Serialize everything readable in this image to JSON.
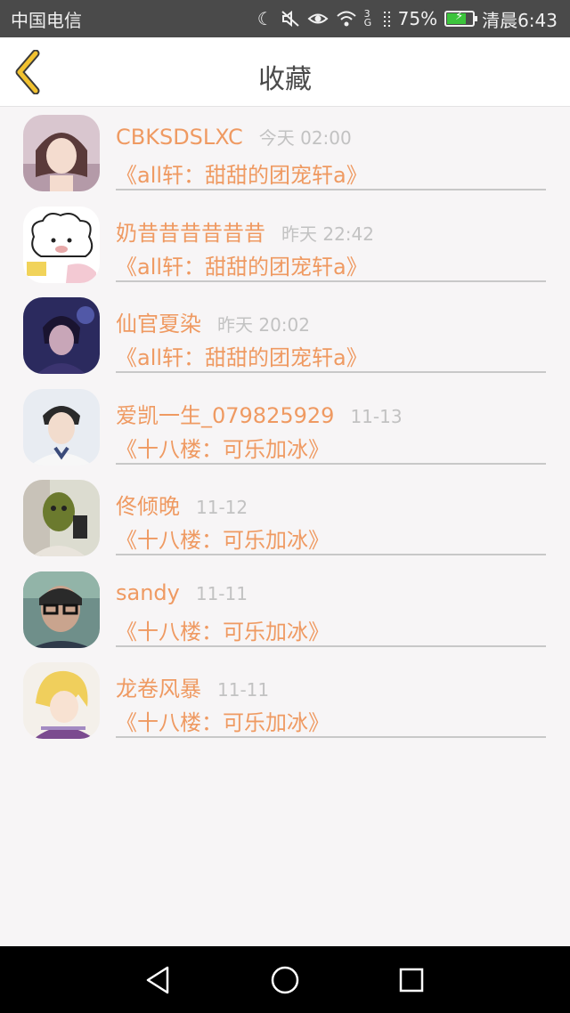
{
  "status_bar": {
    "carrier": "中国电信",
    "network": "3G",
    "battery_percent": "75%",
    "battery_level": 0.75,
    "time": "清晨6:43",
    "icons": [
      "moon-icon",
      "mute-icon",
      "eye-icon",
      "wifi-icon",
      "signal-icon",
      "battery-icon"
    ]
  },
  "header": {
    "title": "收藏",
    "back_icon": "chevron-left-icon",
    "accent_color": "#f2c230"
  },
  "favorites": [
    {
      "user": "CBKSDSLXC",
      "time": "今天 02:00",
      "book": "《all轩：甜甜的团宠轩a》"
    },
    {
      "user": "奶昔昔昔昔昔昔",
      "time": "昨天 22:42",
      "book": "《all轩：甜甜的团宠轩a》"
    },
    {
      "user": "仙官夏染",
      "time": "昨天 20:02",
      "book": "《all轩：甜甜的团宠轩a》"
    },
    {
      "user": "爱凯一生_079825929",
      "time": "11-13",
      "book": "《十八楼：可乐加冰》"
    },
    {
      "user": "佟倾晚",
      "time": "11-12",
      "book": "《十八楼：可乐加冰》"
    },
    {
      "user": "sandy",
      "time": "11-11",
      "book": "《十八楼：可乐加冰》"
    },
    {
      "user": "龙卷风暴",
      "time": "11-11",
      "book": "《十八楼：可乐加冰》"
    }
  ],
  "colors": {
    "name_color": "#ef9a62",
    "time_color": "#c2c2c2",
    "divider": "#c8c8c8"
  },
  "nav": {
    "icons": [
      "back-triangle-icon",
      "home-circle-icon",
      "recents-square-icon"
    ]
  }
}
